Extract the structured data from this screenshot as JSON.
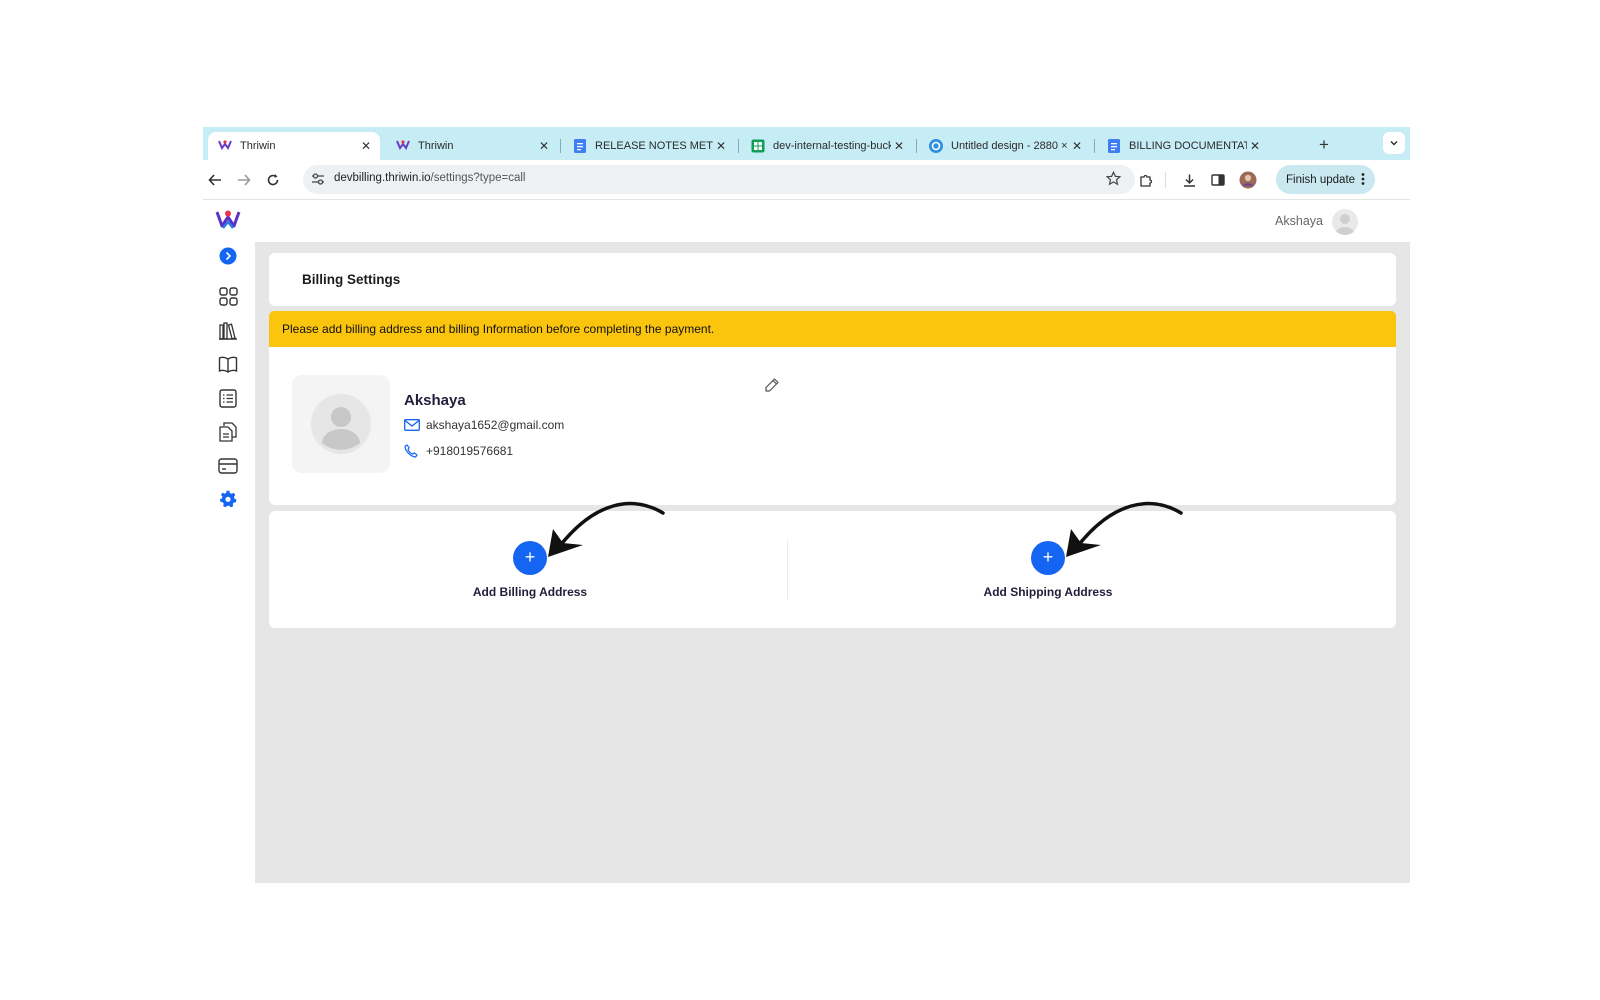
{
  "browser": {
    "tabs": [
      {
        "title": "Thriwin",
        "favicon": "thriwin-logo-icon",
        "active": true
      },
      {
        "title": "Thriwin",
        "favicon": "thriwin-logo-icon",
        "active": false
      },
      {
        "title": "RELEASE NOTES METER",
        "favicon": "google-docs-icon",
        "active": false
      },
      {
        "title": "dev-internal-testing-buck",
        "favicon": "sheets-icon",
        "active": false
      },
      {
        "title": "Untitled design - 2880 ×",
        "favicon": "canva-icon",
        "active": false
      },
      {
        "title": "BILLING DOCUMENTATIO",
        "favicon": "google-docs-icon",
        "active": false
      }
    ],
    "url": {
      "host": "devbilling.thriwin.io",
      "path": "/settings?type=call"
    },
    "finish_update_label": "Finish update",
    "colors": {
      "tabbar": "#c6ecf5",
      "finish_update": "#c9e8f0"
    }
  },
  "sidebar": {
    "items": [
      {
        "icon": "expand-chevron-icon"
      },
      {
        "icon": "dashboard-grid-icon"
      },
      {
        "icon": "library-icon"
      },
      {
        "icon": "book-icon"
      },
      {
        "icon": "list-icon"
      },
      {
        "icon": "documents-icon"
      },
      {
        "icon": "credit-card-icon"
      },
      {
        "icon": "settings-gear-icon",
        "active": true
      }
    ],
    "accent": "#1565f3"
  },
  "header": {
    "user_name": "Akshaya"
  },
  "page": {
    "title": "Billing Settings",
    "banner": "Please add billing address and billing Information before completing the payment.",
    "banner_color": "#fbc40d",
    "profile": {
      "name": "Akshaya",
      "email": "akshaya1652@gmail.com",
      "phone": "+918019576681"
    },
    "billing_label": "Add Billing Address",
    "shipping_label": "Add Shipping Address",
    "add_symbol": "+"
  }
}
